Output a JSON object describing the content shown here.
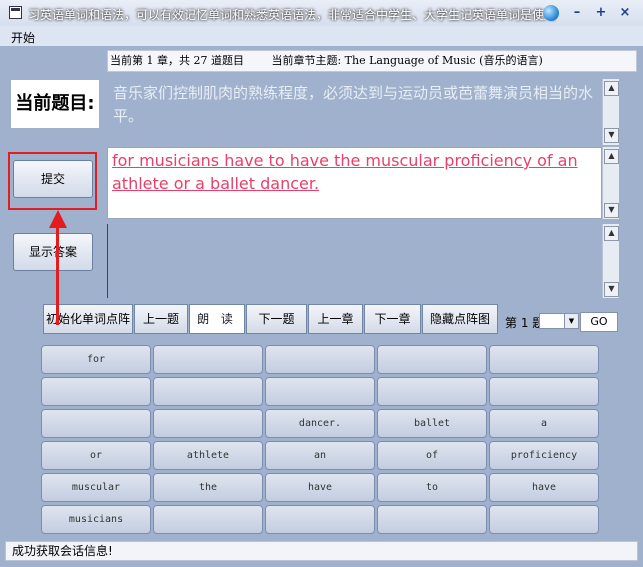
{
  "window": {
    "title": "习英语单词和语法，可以有效记忆单词和熟悉英语语法，非常适合中学生、大学生记英语单词是使用",
    "minimize": "–",
    "maximize": "+",
    "close": "×"
  },
  "menu": {
    "start": "开始"
  },
  "header": {
    "chapter_info": "当前第 1 章，共 27 道题目",
    "topic": "当前章节主题: The Language of Music (音乐的语言)"
  },
  "question_label": "当前题目:",
  "question_text": "音乐家们控制肌肉的熟练程度，必须达到与运动员或芭蕾舞演员相当的水平。",
  "answer_text": "for musicians have to have the muscular proficiency of an athlete or a ballet dancer.",
  "buttons": {
    "submit": "提交",
    "show_answer": "显示答案",
    "init_grid": "初始化单词点阵",
    "prev_question": "上一题",
    "read": "朗 读",
    "next_question": "下一题",
    "prev_chapter": "上一章",
    "next_chapter": "下一章",
    "hide_grid": "隐藏点阵图",
    "go": "GO"
  },
  "page": {
    "label": "第 1 题",
    "select_value": ""
  },
  "word_grid": [
    [
      "for",
      "",
      "",
      "",
      ""
    ],
    [
      "",
      "",
      "",
      "",
      ""
    ],
    [
      "",
      "",
      "dancer.",
      "ballet",
      "a"
    ],
    [
      "or",
      "athlete",
      "an",
      "of",
      "proficiency"
    ],
    [
      "muscular",
      "the",
      "have",
      "to",
      "have"
    ],
    [
      "musicians",
      "",
      "",
      "",
      ""
    ]
  ],
  "status": "成功获取会话信息!"
}
